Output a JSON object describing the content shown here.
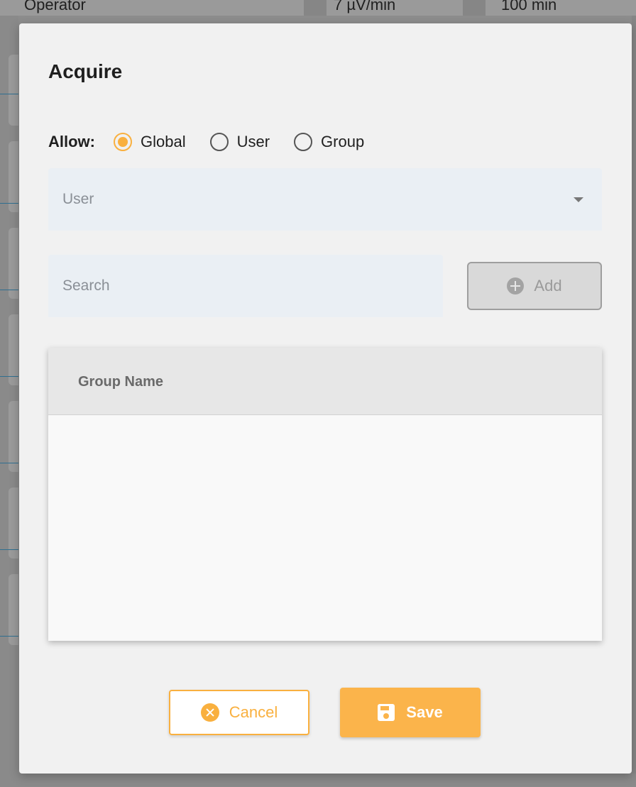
{
  "background": {
    "columns": [
      "Operator",
      "7 µV/min",
      "100 min"
    ]
  },
  "dialog": {
    "title": "Acquire",
    "allow": {
      "label": "Allow:",
      "options": [
        "Global",
        "User",
        "Group"
      ],
      "selected": "Global"
    },
    "user_select": {
      "label": "User"
    },
    "search": {
      "placeholder": "Search"
    },
    "add_button": {
      "label": "Add",
      "icon": "plus-circle-icon",
      "disabled": true
    },
    "table": {
      "columns": [
        "Group Name"
      ],
      "rows": []
    },
    "actions": {
      "cancel_label": "Cancel",
      "save_label": "Save"
    }
  },
  "colors": {
    "accent": "#f9b03f",
    "field_background": "#eaeff4",
    "dialog_background": "#f1f1f1"
  }
}
